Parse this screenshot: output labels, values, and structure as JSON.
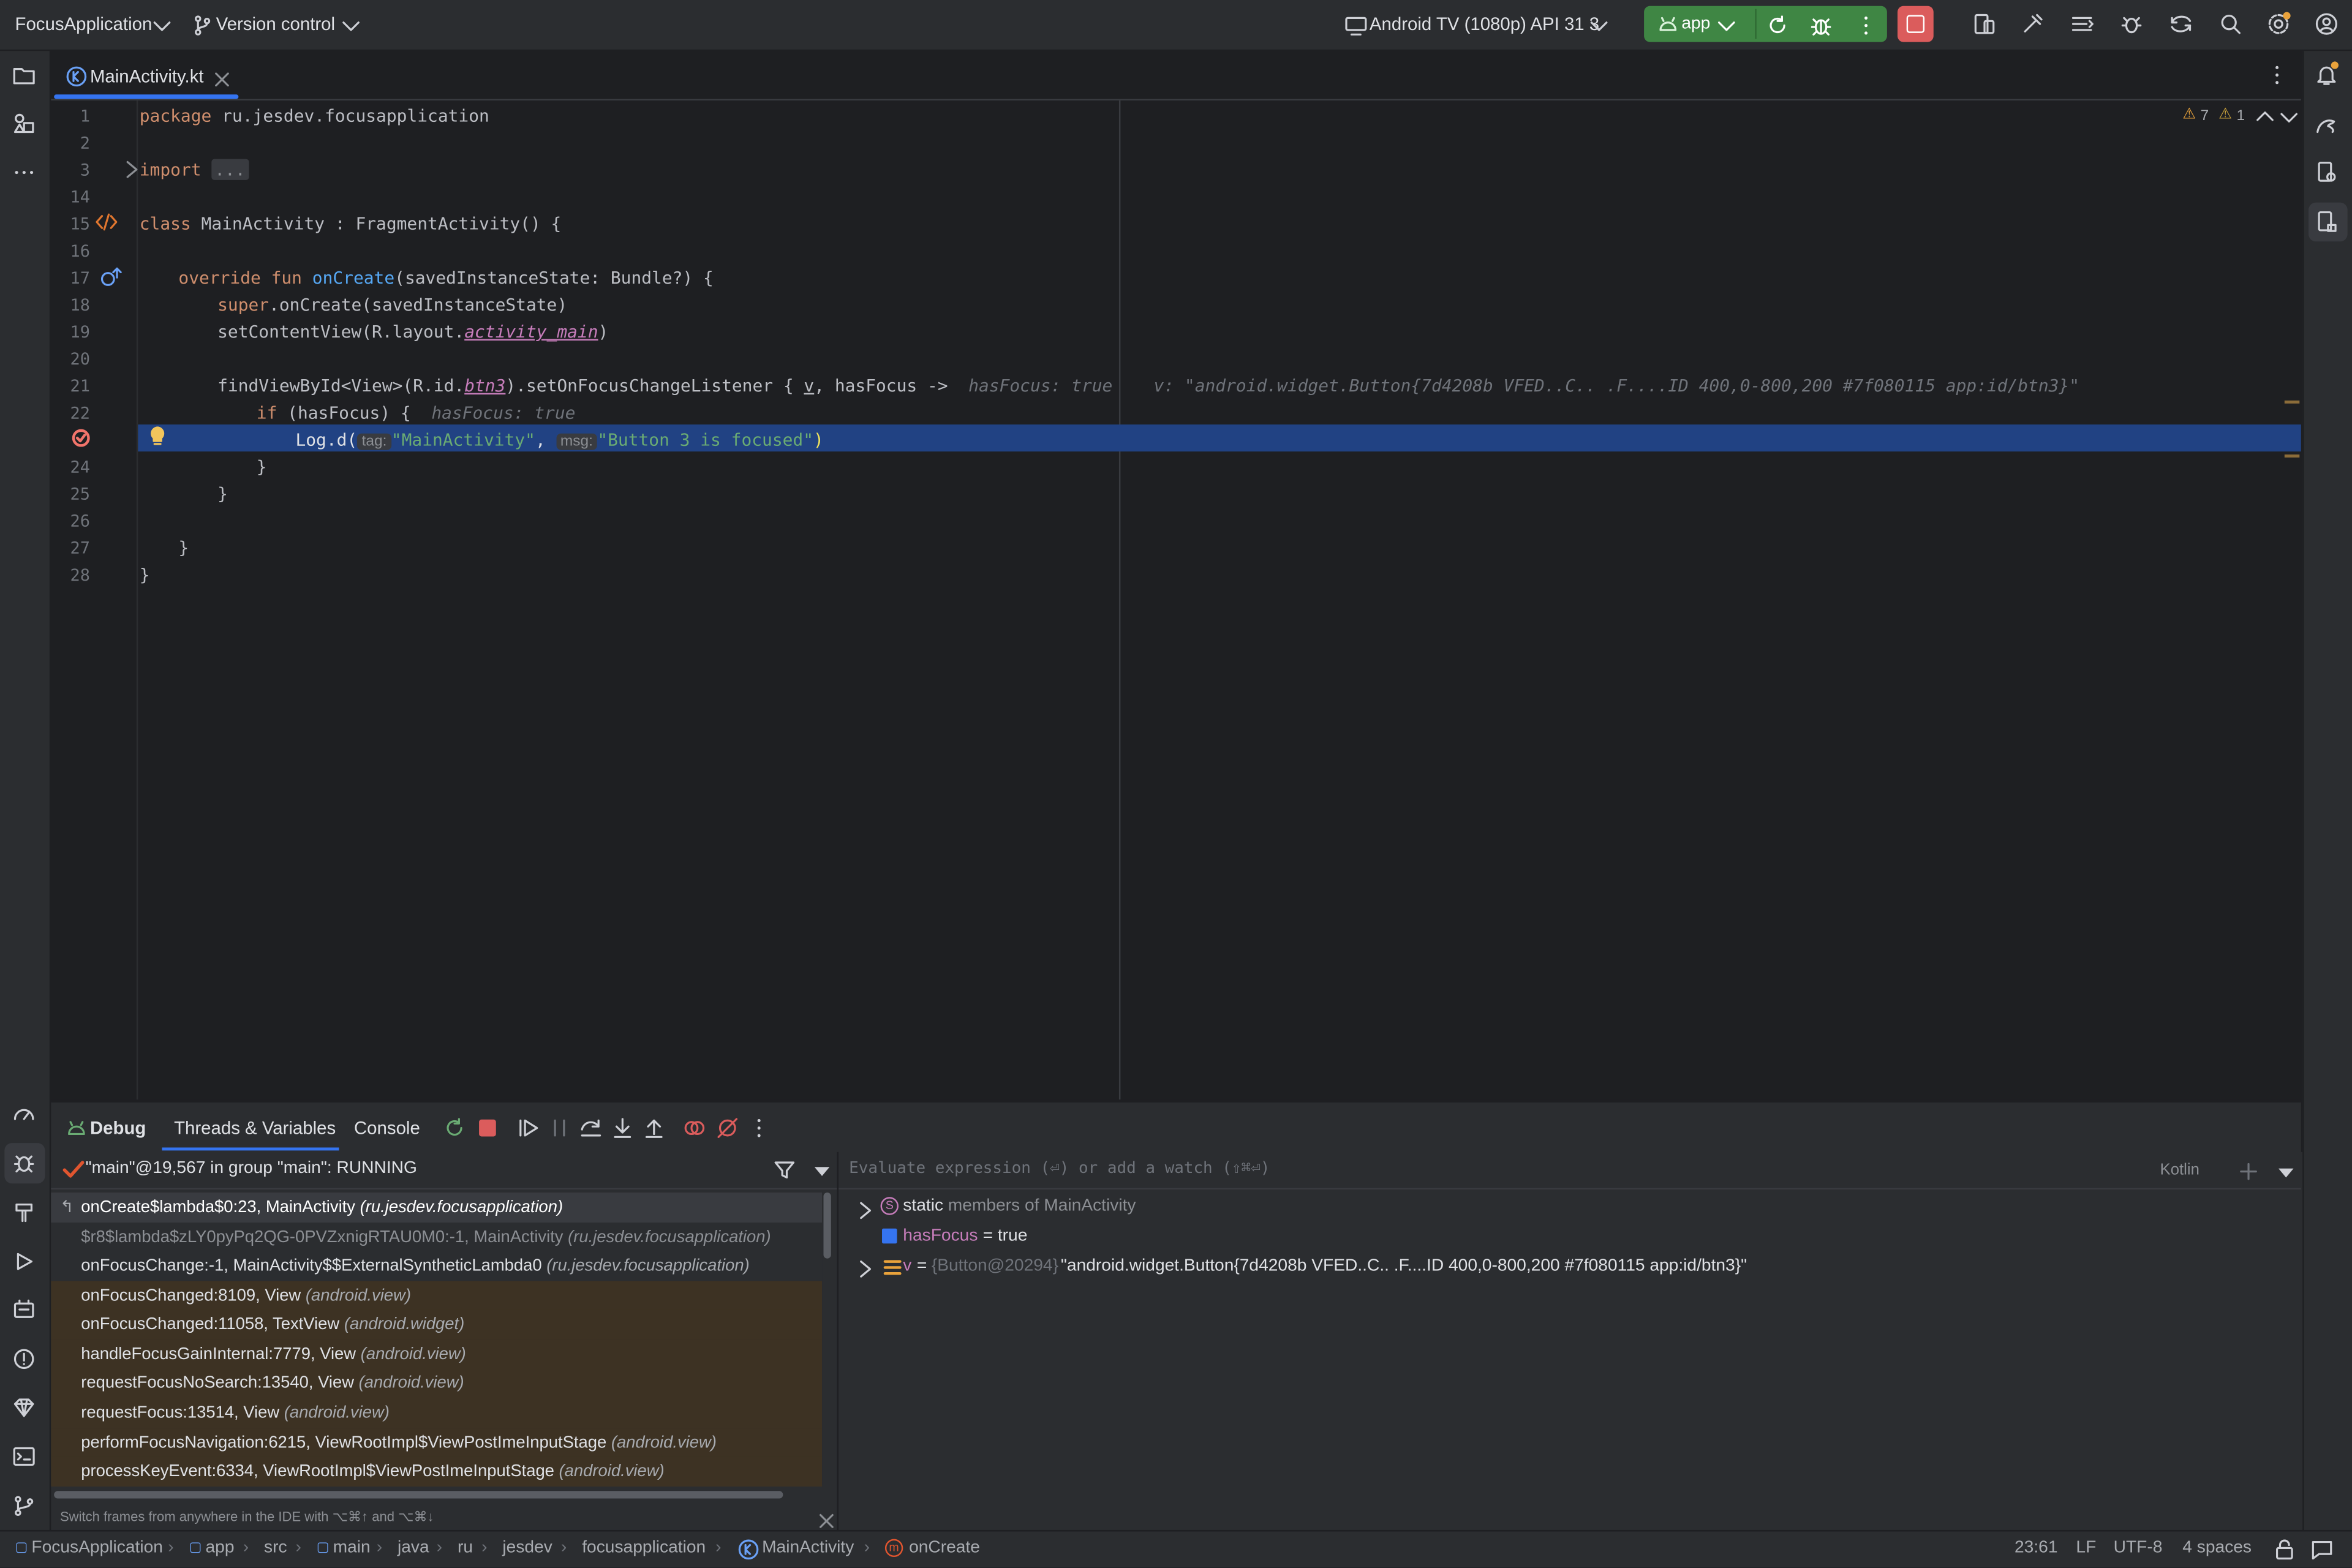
{
  "topbar": {
    "project": "FocusApplication",
    "vcs": "Version control",
    "device": "Android TV (1080p) API 31 3",
    "run_config": "app"
  },
  "editor": {
    "tab": "MainActivity.kt",
    "warnings": "7",
    "weak_warnings": "1",
    "line_numbers": [
      "1",
      "2",
      "3",
      "14",
      "15",
      "16",
      "17",
      "18",
      "19",
      "20",
      "21",
      "22",
      "",
      "24",
      "25",
      "26",
      "27",
      "28"
    ],
    "code": {
      "l1_kw": "package",
      "l1_rest": " ru.jesdev.focusapplication",
      "l3_kw": "import",
      "l3_fold": "...",
      "l15_kw": "class",
      "l15_rest": " MainActivity : FragmentActivity() {",
      "l17_kw": "override fun",
      "l17_fn": "onCreate",
      "l17_rest": "(savedInstanceState: Bundle?) {",
      "l18_kw": "super",
      "l18_rest": ".onCreate(savedInstanceState)",
      "l19_a": "setContentView(R.layout.",
      "l19_b": "activity_main",
      "l19_c": ")",
      "l21_a": "findViewById<View>(R.id.",
      "l21_b": "btn3",
      "l21_c": ").setOnFocusChangeListener { ",
      "l21_d": "v",
      "l21_e": ", hasFocus ->",
      "l21_hint1": "hasFocus: true",
      "l21_hint2": "v: \"android.widget.Button{7d4208b VFED..C.. .F....ID 400,0-800,200 #7f080115 app:id/btn3}\"",
      "l22_kw": "if",
      "l22_rest": " (hasFocus) {",
      "l22_hint": "hasFocus: true",
      "l23_a": "Log.d(",
      "l23_tag_hint": "tag:",
      "l23_tag": "\"MainActivity\"",
      "l23_comma": ", ",
      "l23_msg_hint": "msg:",
      "l23_msg": "\"Button 3 is focused\"",
      "l23_end": ")",
      "l24": "}",
      "l25": "}",
      "l27": "}",
      "l28": "}"
    }
  },
  "debug": {
    "tab_debug": "Debug",
    "tab_threads": "Threads & Variables",
    "tab_console": "Console",
    "thread": "\"main\"@19,567 in group \"main\": RUNNING",
    "eval_placeholder": "Evaluate expression (⏎) or add a watch (⇧⌘⏎)",
    "lang": "Kotlin",
    "frames": [
      {
        "name": "onCreate$lambda$0:23, MainActivity",
        "pkg": "(ru.jesdev.focusapplication)"
      },
      {
        "name": "$r8$lambda$zLY0pyPq2QG-0PVZxnigRTAU0M0:-1, MainActivity",
        "pkg": "(ru.jesdev.focusapplication)"
      },
      {
        "name": "onFocusChange:-1, MainActivity$$ExternalSyntheticLambda0",
        "pkg": "(ru.jesdev.focusapplication)"
      },
      {
        "name": "onFocusChanged:8109, View",
        "pkg": "(android.view)"
      },
      {
        "name": "onFocusChanged:11058, TextView",
        "pkg": "(android.widget)"
      },
      {
        "name": "handleFocusGainInternal:7779, View",
        "pkg": "(android.view)"
      },
      {
        "name": "requestFocusNoSearch:13540, View",
        "pkg": "(android.view)"
      },
      {
        "name": "requestFocus:13514, View",
        "pkg": "(android.view)"
      },
      {
        "name": "performFocusNavigation:6215, ViewRootImpl$ViewPostImeInputStage",
        "pkg": "(android.view)"
      },
      {
        "name": "processKeyEvent:6334, ViewRootImpl$ViewPostImeInputStage",
        "pkg": "(android.view)"
      }
    ],
    "frames_hint": "Switch frames from anywhere in the IDE with ⌥⌘↑ and ⌥⌘↓",
    "vars": {
      "static_label": "static",
      "static_rest": "members of MainActivity",
      "hasfocus_name": "hasFocus",
      "hasfocus_val": " = true",
      "v_name": "v",
      "v_eq": " = ",
      "v_type": "{Button@20294}",
      "v_val": " \"android.widget.Button{7d4208b VFED..C.. .F....ID 400,0-800,200 #7f080115 app:id/btn3}\""
    }
  },
  "statusbar": {
    "crumbs": [
      "FocusApplication",
      "app",
      "src",
      "main",
      "java",
      "ru",
      "jesdev",
      "focusapplication",
      "MainActivity",
      "onCreate"
    ],
    "position": "23:61",
    "line_sep": "LF",
    "encoding": "UTF-8",
    "indent": "4 spaces"
  },
  "colors": {
    "accent": "#3574f0",
    "run": "#3f8644",
    "stop": "#db5c5c",
    "highlight": "#214283"
  }
}
